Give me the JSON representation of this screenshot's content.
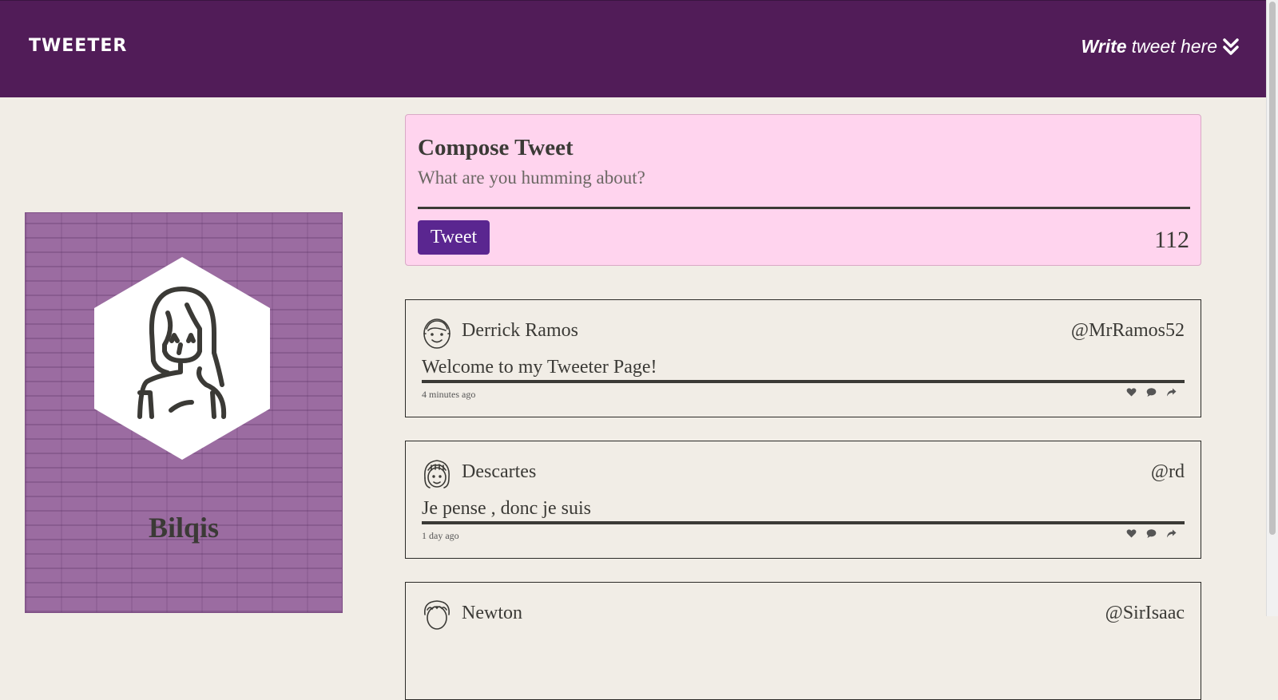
{
  "nav": {
    "brand": "TWEETER",
    "write_bold": "Write",
    "write_rest": "tweet here"
  },
  "profile": {
    "name": "Bilqis"
  },
  "compose": {
    "title": "Compose Tweet",
    "placeholder": "What are you humming about?",
    "button_label": "Tweet",
    "counter": "112"
  },
  "tweets": [
    {
      "name": "Derrick Ramos",
      "handle": "@MrRamos52",
      "content": "Welcome to my Tweeter Page!",
      "time": "4 minutes ago",
      "avatar_icon": "smiling-man-avatar-icon"
    },
    {
      "name": "Descartes",
      "handle": "@rd",
      "content": "Je pense , donc je suis",
      "time": "1 day ago",
      "avatar_icon": "bob-hair-avatar-icon"
    },
    {
      "name": "Newton",
      "handle": "@SirIsaac",
      "content": "",
      "time": "",
      "avatar_icon": "curly-hair-avatar-icon"
    }
  ],
  "colors": {
    "nav_bg": "#511c58",
    "page_bg": "#f1ede6",
    "compose_bg": "#ffd4ee",
    "button_bg": "#5a2690",
    "profile_bg": "#9b6ca1"
  }
}
